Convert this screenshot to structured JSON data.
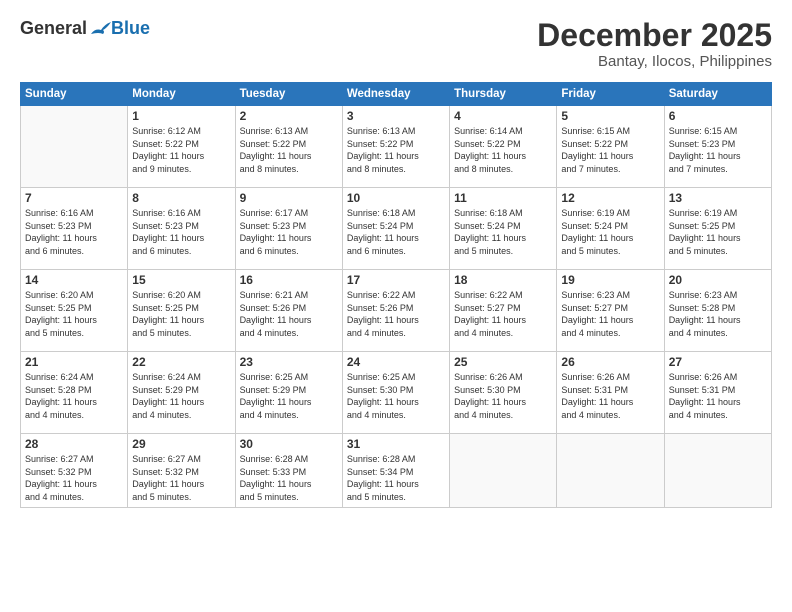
{
  "logo": {
    "general": "General",
    "blue": "Blue"
  },
  "title": "December 2025",
  "location": "Bantay, Ilocos, Philippines",
  "days_header": [
    "Sunday",
    "Monday",
    "Tuesday",
    "Wednesday",
    "Thursday",
    "Friday",
    "Saturday"
  ],
  "weeks": [
    [
      {
        "num": "",
        "info": ""
      },
      {
        "num": "1",
        "info": "Sunrise: 6:12 AM\nSunset: 5:22 PM\nDaylight: 11 hours\nand 9 minutes."
      },
      {
        "num": "2",
        "info": "Sunrise: 6:13 AM\nSunset: 5:22 PM\nDaylight: 11 hours\nand 8 minutes."
      },
      {
        "num": "3",
        "info": "Sunrise: 6:13 AM\nSunset: 5:22 PM\nDaylight: 11 hours\nand 8 minutes."
      },
      {
        "num": "4",
        "info": "Sunrise: 6:14 AM\nSunset: 5:22 PM\nDaylight: 11 hours\nand 8 minutes."
      },
      {
        "num": "5",
        "info": "Sunrise: 6:15 AM\nSunset: 5:22 PM\nDaylight: 11 hours\nand 7 minutes."
      },
      {
        "num": "6",
        "info": "Sunrise: 6:15 AM\nSunset: 5:23 PM\nDaylight: 11 hours\nand 7 minutes."
      }
    ],
    [
      {
        "num": "7",
        "info": "Sunrise: 6:16 AM\nSunset: 5:23 PM\nDaylight: 11 hours\nand 6 minutes."
      },
      {
        "num": "8",
        "info": "Sunrise: 6:16 AM\nSunset: 5:23 PM\nDaylight: 11 hours\nand 6 minutes."
      },
      {
        "num": "9",
        "info": "Sunrise: 6:17 AM\nSunset: 5:23 PM\nDaylight: 11 hours\nand 6 minutes."
      },
      {
        "num": "10",
        "info": "Sunrise: 6:18 AM\nSunset: 5:24 PM\nDaylight: 11 hours\nand 6 minutes."
      },
      {
        "num": "11",
        "info": "Sunrise: 6:18 AM\nSunset: 5:24 PM\nDaylight: 11 hours\nand 5 minutes."
      },
      {
        "num": "12",
        "info": "Sunrise: 6:19 AM\nSunset: 5:24 PM\nDaylight: 11 hours\nand 5 minutes."
      },
      {
        "num": "13",
        "info": "Sunrise: 6:19 AM\nSunset: 5:25 PM\nDaylight: 11 hours\nand 5 minutes."
      }
    ],
    [
      {
        "num": "14",
        "info": "Sunrise: 6:20 AM\nSunset: 5:25 PM\nDaylight: 11 hours\nand 5 minutes."
      },
      {
        "num": "15",
        "info": "Sunrise: 6:20 AM\nSunset: 5:25 PM\nDaylight: 11 hours\nand 5 minutes."
      },
      {
        "num": "16",
        "info": "Sunrise: 6:21 AM\nSunset: 5:26 PM\nDaylight: 11 hours\nand 4 minutes."
      },
      {
        "num": "17",
        "info": "Sunrise: 6:22 AM\nSunset: 5:26 PM\nDaylight: 11 hours\nand 4 minutes."
      },
      {
        "num": "18",
        "info": "Sunrise: 6:22 AM\nSunset: 5:27 PM\nDaylight: 11 hours\nand 4 minutes."
      },
      {
        "num": "19",
        "info": "Sunrise: 6:23 AM\nSunset: 5:27 PM\nDaylight: 11 hours\nand 4 minutes."
      },
      {
        "num": "20",
        "info": "Sunrise: 6:23 AM\nSunset: 5:28 PM\nDaylight: 11 hours\nand 4 minutes."
      }
    ],
    [
      {
        "num": "21",
        "info": "Sunrise: 6:24 AM\nSunset: 5:28 PM\nDaylight: 11 hours\nand 4 minutes."
      },
      {
        "num": "22",
        "info": "Sunrise: 6:24 AM\nSunset: 5:29 PM\nDaylight: 11 hours\nand 4 minutes."
      },
      {
        "num": "23",
        "info": "Sunrise: 6:25 AM\nSunset: 5:29 PM\nDaylight: 11 hours\nand 4 minutes."
      },
      {
        "num": "24",
        "info": "Sunrise: 6:25 AM\nSunset: 5:30 PM\nDaylight: 11 hours\nand 4 minutes."
      },
      {
        "num": "25",
        "info": "Sunrise: 6:26 AM\nSunset: 5:30 PM\nDaylight: 11 hours\nand 4 minutes."
      },
      {
        "num": "26",
        "info": "Sunrise: 6:26 AM\nSunset: 5:31 PM\nDaylight: 11 hours\nand 4 minutes."
      },
      {
        "num": "27",
        "info": "Sunrise: 6:26 AM\nSunset: 5:31 PM\nDaylight: 11 hours\nand 4 minutes."
      }
    ],
    [
      {
        "num": "28",
        "info": "Sunrise: 6:27 AM\nSunset: 5:32 PM\nDaylight: 11 hours\nand 4 minutes."
      },
      {
        "num": "29",
        "info": "Sunrise: 6:27 AM\nSunset: 5:32 PM\nDaylight: 11 hours\nand 5 minutes."
      },
      {
        "num": "30",
        "info": "Sunrise: 6:28 AM\nSunset: 5:33 PM\nDaylight: 11 hours\nand 5 minutes."
      },
      {
        "num": "31",
        "info": "Sunrise: 6:28 AM\nSunset: 5:34 PM\nDaylight: 11 hours\nand 5 minutes."
      },
      {
        "num": "",
        "info": ""
      },
      {
        "num": "",
        "info": ""
      },
      {
        "num": "",
        "info": ""
      }
    ]
  ]
}
